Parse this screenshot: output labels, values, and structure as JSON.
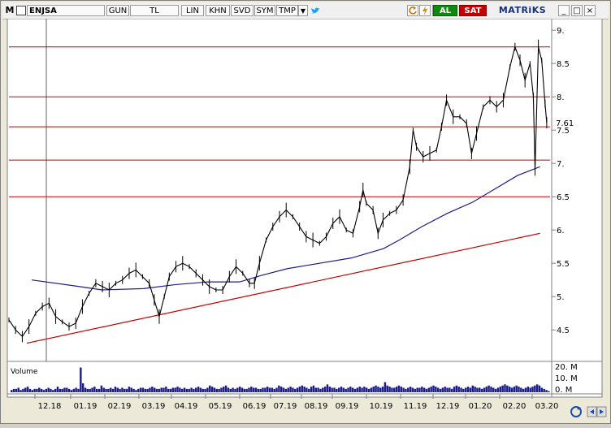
{
  "toolbar": {
    "menu_glyph": "M",
    "symbol": "ENJSA",
    "buttons": [
      "GUN",
      "TL",
      "LIN",
      "KHN",
      "SVD",
      "SYM",
      "TMP"
    ],
    "dropdown_glyph": "▼",
    "al_label": "AL",
    "sat_label": "SAT",
    "brand": "MATRiKS",
    "window_controls": [
      "_",
      "□",
      "×"
    ],
    "icons": [
      "checkbox-icon",
      "twitter-icon",
      "refresh-icon",
      "lightning-icon",
      "circular-arrow-icon"
    ]
  },
  "colors": {
    "price_line": "#000000",
    "moving_average": "#1c1c8c",
    "trend_line": "#c00000",
    "horizontal_levels": "#c00000",
    "volume_bars": "#1c1c8c",
    "al": "#0f8a0f",
    "sat": "#c40000"
  },
  "chart_data": [
    {
      "type": "line",
      "title": "",
      "symbol": "ENJSA",
      "y_ticks": [
        "9.",
        "8.5",
        "8.",
        "7.5",
        "7.",
        "6.5",
        "6.",
        "5.5",
        "5.",
        "4.5"
      ],
      "ylim": [
        4.1,
        9.1
      ],
      "last_price_label": "7.61",
      "x_ticks": [
        "12.18",
        "01.19",
        "02.19",
        "03.19",
        "04.19",
        "05.19",
        "06.19",
        "07.19",
        "08.19",
        "09.19",
        "10.19",
        "11.19",
        "12.19",
        "01.20",
        "02.20",
        "03.20"
      ],
      "horizontal_levels": [
        8.75,
        8.0,
        7.55,
        7.05,
        6.5
      ],
      "trend_line": [
        [
          0.0,
          4.3
        ],
        [
          15.9,
          5.95
        ]
      ],
      "moving_average": [
        [
          0.0,
          5.25
        ],
        [
          1.5,
          5.15
        ],
        [
          2.2,
          5.1
        ],
        [
          3.5,
          5.12
        ],
        [
          4.5,
          5.18
        ],
        [
          5.5,
          5.22
        ],
        [
          6.5,
          5.22
        ],
        [
          7.2,
          5.32
        ],
        [
          8.0,
          5.42
        ],
        [
          9.0,
          5.5
        ],
        [
          10.0,
          5.58
        ],
        [
          11.0,
          5.72
        ],
        [
          11.5,
          5.85
        ],
        [
          12.2,
          6.05
        ],
        [
          13.0,
          6.25
        ],
        [
          13.8,
          6.42
        ],
        [
          14.5,
          6.62
        ],
        [
          15.2,
          6.82
        ],
        [
          15.9,
          6.95
        ]
      ],
      "price": [
        [
          0.0,
          4.65
        ],
        [
          0.2,
          4.5
        ],
        [
          0.4,
          4.4
        ],
        [
          0.6,
          4.55
        ],
        [
          0.8,
          4.75
        ],
        [
          1.0,
          4.85
        ],
        [
          1.2,
          4.9
        ],
        [
          1.4,
          4.7
        ],
        [
          1.6,
          4.62
        ],
        [
          1.8,
          4.55
        ],
        [
          2.0,
          4.6
        ],
        [
          2.2,
          4.85
        ],
        [
          2.4,
          5.05
        ],
        [
          2.6,
          5.2
        ],
        [
          2.8,
          5.15
        ],
        [
          3.0,
          5.1
        ],
        [
          3.2,
          5.2
        ],
        [
          3.4,
          5.25
        ],
        [
          3.6,
          5.35
        ],
        [
          3.8,
          5.4
        ],
        [
          4.0,
          5.3
        ],
        [
          4.2,
          5.2
        ],
        [
          4.35,
          4.95
        ],
        [
          4.5,
          4.7
        ],
        [
          4.65,
          5.0
        ],
        [
          4.8,
          5.3
        ],
        [
          5.0,
          5.45
        ],
        [
          5.2,
          5.5
        ],
        [
          5.4,
          5.45
        ],
        [
          5.6,
          5.35
        ],
        [
          5.8,
          5.25
        ],
        [
          6.0,
          5.15
        ],
        [
          6.2,
          5.1
        ],
        [
          6.4,
          5.1
        ],
        [
          6.6,
          5.3
        ],
        [
          6.8,
          5.45
        ],
        [
          7.0,
          5.35
        ],
        [
          7.2,
          5.2
        ],
        [
          7.35,
          5.2
        ],
        [
          7.5,
          5.5
        ],
        [
          7.7,
          5.85
        ],
        [
          7.9,
          6.05
        ],
        [
          8.1,
          6.2
        ],
        [
          8.3,
          6.3
        ],
        [
          8.5,
          6.2
        ],
        [
          8.7,
          6.05
        ],
        [
          8.9,
          5.9
        ],
        [
          9.1,
          5.85
        ],
        [
          9.3,
          5.8
        ],
        [
          9.5,
          5.9
        ],
        [
          9.7,
          6.1
        ],
        [
          9.9,
          6.2
        ],
        [
          10.1,
          6.0
        ],
        [
          10.3,
          5.95
        ],
        [
          10.5,
          6.35
        ],
        [
          10.6,
          6.6
        ],
        [
          10.7,
          6.4
        ],
        [
          10.9,
          6.3
        ],
        [
          11.05,
          5.95
        ],
        [
          11.2,
          6.15
        ],
        [
          11.4,
          6.25
        ],
        [
          11.6,
          6.3
        ],
        [
          11.8,
          6.45
        ],
        [
          12.0,
          6.95
        ],
        [
          12.1,
          7.5
        ],
        [
          12.2,
          7.25
        ],
        [
          12.4,
          7.1
        ],
        [
          12.6,
          7.15
        ],
        [
          12.8,
          7.2
        ],
        [
          12.95,
          7.55
        ],
        [
          13.1,
          7.95
        ],
        [
          13.3,
          7.7
        ],
        [
          13.5,
          7.7
        ],
        [
          13.7,
          7.6
        ],
        [
          13.85,
          7.15
        ],
        [
          14.0,
          7.45
        ],
        [
          14.2,
          7.85
        ],
        [
          14.4,
          7.95
        ],
        [
          14.6,
          7.85
        ],
        [
          14.8,
          7.95
        ],
        [
          15.0,
          8.45
        ],
        [
          15.15,
          8.75
        ],
        [
          15.3,
          8.55
        ],
        [
          15.45,
          8.25
        ],
        [
          15.6,
          8.5
        ],
        [
          15.7,
          8.0
        ],
        [
          15.75,
          6.9
        ],
        [
          15.85,
          8.75
        ],
        [
          15.95,
          8.55
        ],
        [
          16.05,
          7.9
        ],
        [
          16.1,
          7.61
        ]
      ],
      "volume": {
        "label": "Volume",
        "y_ticks": [
          "20. M",
          "10. M",
          "0. M"
        ],
        "ylim": [
          0,
          26
        ],
        "values": [
          2,
          3,
          3,
          4,
          2,
          3,
          4,
          5,
          3,
          2,
          3,
          3,
          4,
          3,
          2,
          3,
          4,
          3,
          2,
          3,
          5,
          3,
          3,
          4,
          4,
          3,
          2,
          3,
          4,
          3,
          22,
          8,
          4,
          3,
          3,
          4,
          5,
          3,
          3,
          6,
          4,
          3,
          3,
          4,
          3,
          5,
          4,
          3,
          4,
          3,
          3,
          5,
          4,
          3,
          2,
          3,
          4,
          4,
          3,
          3,
          4,
          5,
          4,
          3,
          3,
          4,
          4,
          5,
          3,
          3,
          4,
          4,
          5,
          4,
          3,
          4,
          3,
          3,
          4,
          3,
          4,
          5,
          4,
          3,
          3,
          4,
          6,
          5,
          4,
          3,
          3,
          4,
          5,
          6,
          4,
          3,
          4,
          3,
          4,
          5,
          4,
          3,
          3,
          4,
          5,
          4,
          4,
          3,
          3,
          4,
          4,
          5,
          4,
          4,
          3,
          4,
          6,
          5,
          4,
          3,
          4,
          5,
          4,
          3,
          4,
          5,
          6,
          5,
          4,
          3,
          5,
          6,
          4,
          4,
          3,
          4,
          5,
          7,
          5,
          4,
          4,
          3,
          4,
          5,
          4,
          3,
          4,
          5,
          4,
          3,
          4,
          5,
          4,
          5,
          4,
          3,
          4,
          5,
          6,
          5,
          4,
          5,
          9,
          6,
          5,
          4,
          4,
          5,
          6,
          5,
          4,
          3,
          4,
          5,
          4,
          3,
          4,
          4,
          5,
          4,
          3,
          4,
          5,
          6,
          5,
          4,
          3,
          4,
          5,
          4,
          4,
          3,
          5,
          6,
          5,
          4,
          3,
          4,
          5,
          4,
          6,
          5,
          4,
          4,
          3,
          4,
          5,
          6,
          5,
          4,
          3,
          4,
          5,
          6,
          7,
          6,
          5,
          4,
          5,
          6,
          5,
          4,
          3,
          4,
          5,
          4,
          5,
          6,
          7,
          6,
          4,
          3,
          2,
          1
        ]
      }
    }
  ],
  "bottom_controls": [
    "refresh-cycle-icon",
    "scroll-left-icon",
    "scroll-right-icon"
  ]
}
